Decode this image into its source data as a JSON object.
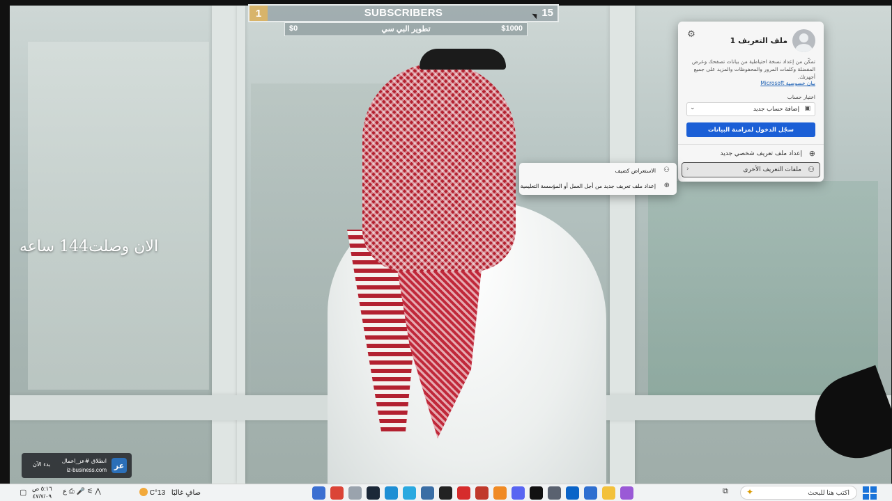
{
  "subscribers": {
    "current_count": "1",
    "title": "SUBSCRIBERS",
    "goal_count": "15",
    "goal_bar": {
      "amount_left": "$0",
      "label": "تطوير البي سي",
      "amount_right": "$1000"
    }
  },
  "overlay_text": "الان وصلت144 ساعه",
  "profile_panel": {
    "profile_name": "ملف التعريف 1",
    "description": "تمكّن من إعداد نسخة احتياطية من بيانات تصفحك وعرض المفضلة وكلمات المرور والمحفوظات والمزيد على جميع أجهزتك.",
    "privacy_link": "بيان خصوصية Microsoft",
    "choose_account_label": "اختيار حساب",
    "account_select_value": "إضافة حساب جديد",
    "sync_button": "سجّل الدخول لمزامنة البيانات",
    "new_profile": "إعداد ملف تعريف شخصي جديد",
    "other_profiles": "ملفات التعريف الأخرى"
  },
  "submenu": {
    "guest_browsing": "الاستعراض كضيف",
    "work_profile": "إعداد ملف تعريف جديد من أجل العمل أو المؤسسة التعليمية"
  },
  "iz_badge": {
    "line1": "انطلاق #عز_اعمال",
    "line2": "iz-business.com",
    "start": "بدء الآن",
    "logo": "عز"
  },
  "taskbar": {
    "time": "٥:١٦ ص",
    "date": "٤٧/٧/٠٩",
    "temperature": "13°C",
    "weather_desc": "صافٍ غالبًا",
    "search_placeholder": "اكتب هنا للبحث",
    "apps": [
      {
        "name": "sticky-app-icon",
        "color": "#3b6fd1"
      },
      {
        "name": "chrome-icon",
        "color": "#db4437"
      },
      {
        "name": "settings-app-icon",
        "color": "#9aa3ad"
      },
      {
        "name": "steam-icon",
        "color": "#1b2838"
      },
      {
        "name": "edge-icon",
        "color": "#1f8fd4"
      },
      {
        "name": "file-app-icon",
        "color": "#2aa9e0"
      },
      {
        "name": "shield-app-icon",
        "color": "#3a6ea5"
      },
      {
        "name": "epic-games-icon",
        "color": "#222222"
      },
      {
        "name": "bandicam-icon",
        "color": "#d62c2c"
      },
      {
        "name": "recorder-icon",
        "color": "#c0392b"
      },
      {
        "name": "vlc-icon",
        "color": "#f08a24"
      },
      {
        "name": "discord-icon",
        "color": "#5865f2"
      },
      {
        "name": "capcut-icon",
        "color": "#111111"
      },
      {
        "name": "printer-icon",
        "color": "#5a6270"
      },
      {
        "name": "outlook-icon",
        "color": "#0a64c8"
      },
      {
        "name": "store-icon",
        "color": "#2f6fd0"
      },
      {
        "name": "folder-icon",
        "color": "#f3c13c"
      },
      {
        "name": "copilot-icon",
        "color": "#9a59d6"
      }
    ]
  }
}
